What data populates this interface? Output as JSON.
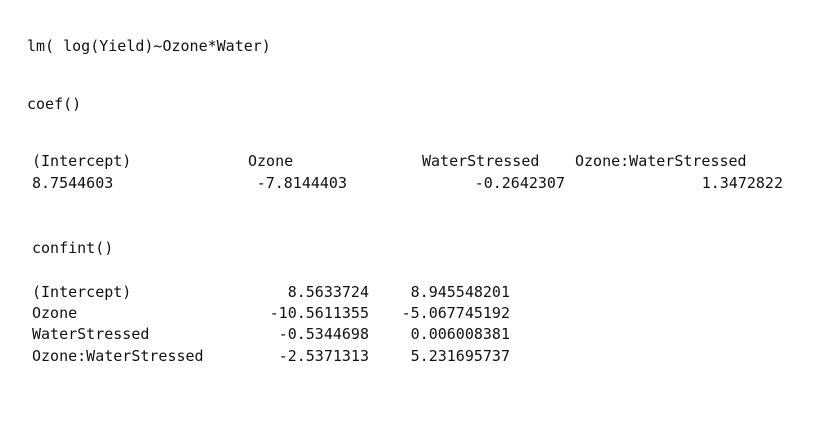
{
  "model_call": "lm( log(Yield)~Ozone*Water)",
  "coef": {
    "call": "coef()",
    "headers": [
      "(Intercept)",
      "Ozone",
      "WaterStressed",
      "Ozone:WaterStressed"
    ],
    "values": [
      "8.7544603",
      "-7.8144403",
      "-0.2642307",
      "1.3472822"
    ]
  },
  "confint": {
    "call": "confint()",
    "rows": [
      {
        "term": "(Intercept)",
        "lower": "8.5633724",
        "upper": "8.945548201"
      },
      {
        "term": "Ozone",
        "lower": "-10.5611355",
        "upper": "-5.067745192"
      },
      {
        "term": "WaterStressed",
        "lower": "-0.5344698",
        "upper": "0.006008381"
      },
      {
        "term": "Ozone:WaterStressed",
        "lower": "-2.5371313",
        "upper": "5.231695737"
      }
    ]
  }
}
